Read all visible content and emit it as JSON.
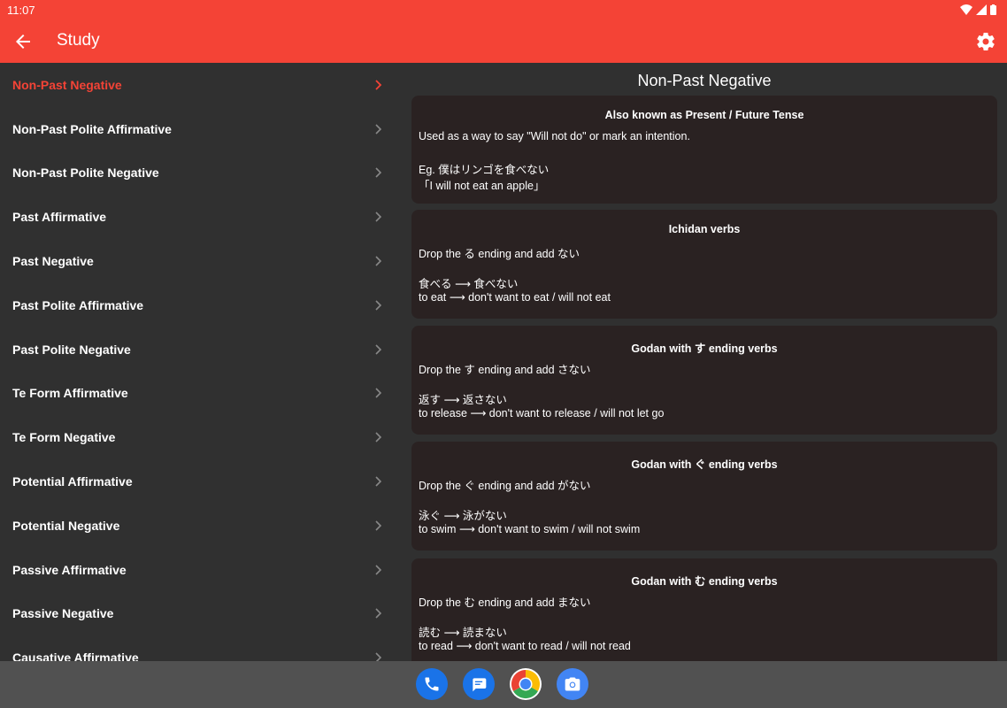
{
  "status": {
    "time": "11:07"
  },
  "appbar": {
    "title": "Study"
  },
  "colors": {
    "accent": "#f44336",
    "background": "#303030",
    "card": "#2a2222"
  },
  "sidebar": {
    "items": [
      {
        "label": "Non-Past Negative",
        "active": true
      },
      {
        "label": "Non-Past Polite Affirmative"
      },
      {
        "label": "Non-Past Polite Negative"
      },
      {
        "label": "Past Affirmative"
      },
      {
        "label": "Past Negative"
      },
      {
        "label": "Past Polite Affirmative"
      },
      {
        "label": "Past Polite Negative"
      },
      {
        "label": "Te Form Affirmative"
      },
      {
        "label": "Te Form Negative"
      },
      {
        "label": "Potential Affirmative"
      },
      {
        "label": "Potential Negative"
      },
      {
        "label": "Passive Affirmative"
      },
      {
        "label": "Passive Negative"
      },
      {
        "label": "Causative Affirmative"
      }
    ]
  },
  "main": {
    "title": "Non-Past Negative",
    "cards": [
      {
        "title": "Also known as Present / Future Tense",
        "desc": "Used as a way to say \"Will not do\" or mark an intention.",
        "line1": "Eg. 僕はリンゴを食べない",
        "line2": "「I will not eat an apple」"
      },
      {
        "title": "Ichidan verbs",
        "desc": "Drop the る ending and add ない",
        "line1": "食べる  ⟶  食べない",
        "line2": "to eat  ⟶  don't want to eat / will not eat"
      },
      {
        "title": "Godan with す ending verbs",
        "desc": "Drop the す ending and add さない",
        "line1": "返す  ⟶  返さない",
        "line2": "to release  ⟶  don't want to release / will not let go"
      },
      {
        "title": "Godan with ぐ ending verbs",
        "desc": "Drop the ぐ ending and add がない",
        "line1": "泳ぐ  ⟶  泳がない",
        "line2": "to swim  ⟶  don't want to swim / will not swim"
      },
      {
        "title": "Godan with む ending verbs",
        "desc": "Drop the む ending and add まない",
        "line1": "読む  ⟶  読まない",
        "line2": "to read  ⟶  don't want to read / will not read"
      }
    ]
  },
  "dock": {
    "icons": [
      "phone-icon",
      "messages-icon",
      "chrome-icon",
      "camera-icon"
    ]
  }
}
